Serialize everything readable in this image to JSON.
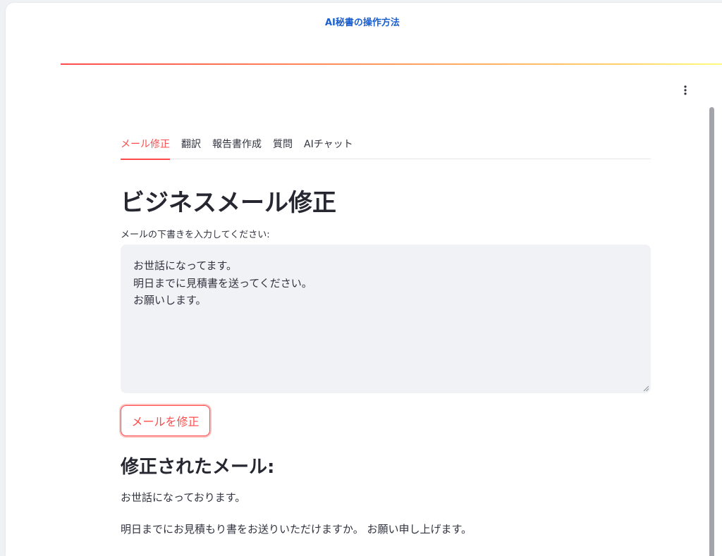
{
  "app": {
    "top_link": "AI秘書の操作方法"
  },
  "tabs": [
    {
      "label": "メール修正",
      "active": true
    },
    {
      "label": "翻訳",
      "active": false
    },
    {
      "label": "報告書作成",
      "active": false
    },
    {
      "label": "質問",
      "active": false
    },
    {
      "label": "AIチャット",
      "active": false
    }
  ],
  "main": {
    "title": "ビジネスメール修正",
    "input_label": "メールの下書きを入力してください:",
    "input_value": "お世話になってます。\n明日までに見積書を送ってください。\nお願いします。",
    "submit_label": "メールを修正",
    "result_title": "修正されたメール:",
    "result_lines": [
      "お世話になっております。",
      "明日までにお見積もり書をお送りいただけますか。 お願い申し上げます。"
    ]
  },
  "colors": {
    "accent": "#ff4b4b",
    "link": "#1a5fd0",
    "text": "#31333f",
    "input_bg": "#f0f2f6"
  },
  "icons": {
    "menu": "vertical-dots-icon",
    "resize": "resize-handle-icon"
  }
}
